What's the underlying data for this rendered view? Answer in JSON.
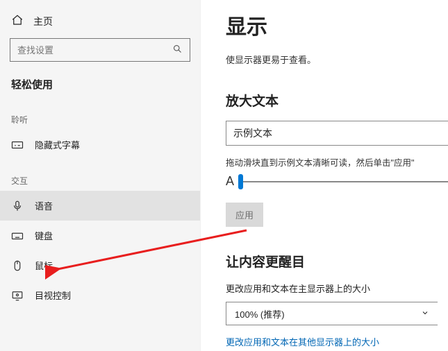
{
  "sidebar": {
    "home_label": "主页",
    "search_placeholder": "查找设置",
    "group_title": "轻松使用",
    "cat_listen": "聆听",
    "item_captions": "隐藏式字幕",
    "cat_interact": "交互",
    "item_speech": "语音",
    "item_keyboard": "键盘",
    "item_mouse": "鼠标",
    "item_eye": "目视控制"
  },
  "main": {
    "title": "显示",
    "subtitle": "使显示器更易于查看。",
    "section_text_title": "放大文本",
    "sample_text": "示例文本",
    "slider_instruction": "拖动滑块直到示例文本清晰可读，然后单击\"应用\"",
    "apply_label": "应用",
    "section_content_title": "让内容更醒目",
    "scale_label": "更改应用和文本在主显示器上的大小",
    "scale_value": "100% (推荐)",
    "scale_link": "更改应用和文本在其他显示器上的大小"
  }
}
